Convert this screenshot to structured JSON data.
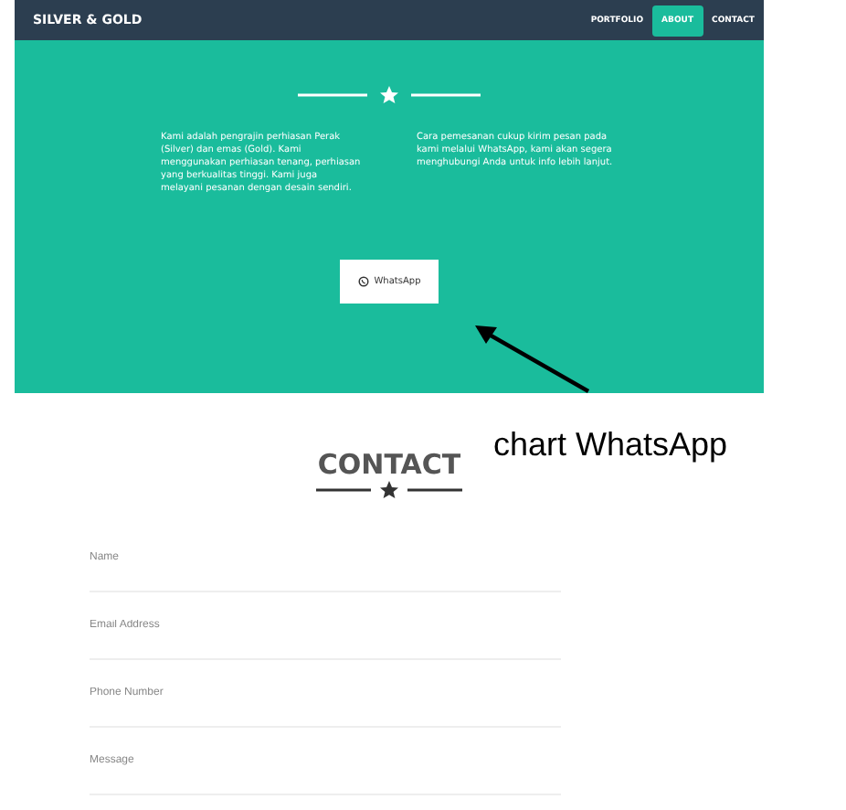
{
  "nav": {
    "brand": "SILVER & GOLD",
    "items": [
      {
        "label": "PORTFOLIO",
        "selected": false
      },
      {
        "label": "ABOUT",
        "selected": true
      },
      {
        "label": "CONTACT",
        "selected": false
      }
    ]
  },
  "about": {
    "paragraphs": [
      "Kami adalah pengrajin perhiasan Perak (Silver) dan emas (Gold). Kami menggunakan perhiasan tenang, perhiasan yang berkualitas tinggi. Kami juga melayani pesanan dengan desain sendiri.",
      "Cara pemesanan cukup kirim pesan pada kami melalui WhatsApp, kami akan segera menghubungi Anda untuk info lebih lanjut."
    ],
    "button": {
      "label": "WhatsApp"
    }
  },
  "contact": {
    "title": "CONTACT",
    "fields": [
      {
        "placeholder": "Name"
      },
      {
        "placeholder": "Email Address"
      },
      {
        "placeholder": "Phone Number"
      },
      {
        "placeholder": "Message"
      }
    ]
  },
  "annotation": {
    "text": "chart WhatsApp"
  }
}
